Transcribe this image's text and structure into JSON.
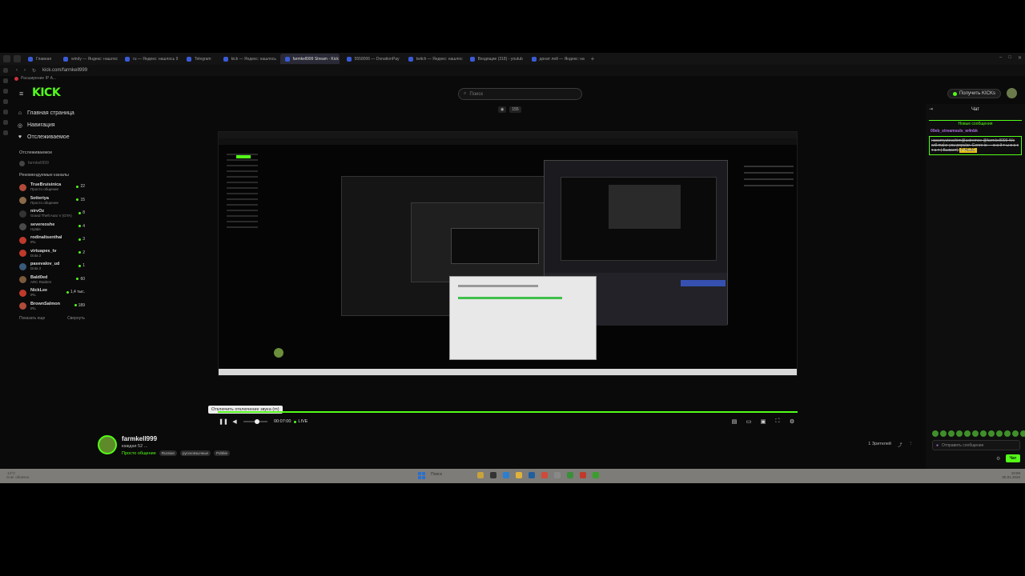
{
  "browser": {
    "tabs": [
      {
        "label": "Главная",
        "active": false
      },
      {
        "label": "windy — Яндекс: нашлось",
        "active": false
      },
      {
        "label": "ru — Яндекс: нашлось 9",
        "active": false
      },
      {
        "label": "Telegram",
        "active": false
      },
      {
        "label": "kick — Яндекс: нашлось",
        "active": false
      },
      {
        "label": "farmkell999 Stream - Kick",
        "active": true
      },
      {
        "label": "5558006 — DonationPay",
        "active": false
      },
      {
        "label": "twitch — Яндекс: нашлось",
        "active": false
      },
      {
        "label": "Входящие (318) - youtub",
        "active": false
      },
      {
        "label": "донат лей — Яндекс: на",
        "active": false
      }
    ],
    "new_tab": "+",
    "url": "kick.com/farmkell999",
    "extension_label": "Расширение IP А..."
  },
  "header": {
    "logo": "KICK",
    "search_placeholder": "Поиск",
    "get_kicks": "Получить KICKs"
  },
  "nav": {
    "items": [
      {
        "icon": "⌂",
        "label": "Главная страница"
      },
      {
        "icon": "◎",
        "label": "Навигация"
      },
      {
        "icon": "♥",
        "label": "Отслеживаемое"
      }
    ],
    "followed_title": "Отслеживаемое",
    "followed_user": "farmkell999",
    "recommended_title": "Рекомендуемые каналы",
    "channels": [
      {
        "name": "TrueBruisinica",
        "game": "Просто общение",
        "viewers": "22",
        "color": "#b04a3a"
      },
      {
        "name": "5otteriya",
        "game": "Просто общение",
        "viewers": "15",
        "color": "#8a6a4a"
      },
      {
        "name": "nirvOz",
        "game": "Grand Theft Auto V (GTA)",
        "viewers": "8",
        "color": "#333333"
      },
      {
        "name": "severeoshe",
        "game": "Hytale",
        "viewers": "4",
        "color": "#4a4a4a"
      },
      {
        "name": "rodinaltsenthal",
        "game": "IRL",
        "viewers": "3",
        "color": "#c0392b"
      },
      {
        "name": "virtuapes_tv",
        "game": "Dota 2",
        "viewers": "2",
        "color": "#c0392b"
      },
      {
        "name": "pasevalov_ud",
        "game": "Dota 2",
        "viewers": "1",
        "color": "#3a5a7a"
      },
      {
        "name": "Bald0ed",
        "game": "ARC Raiders",
        "viewers": "60",
        "color": "#7a5a3a"
      },
      {
        "name": "NickLee",
        "game": "IRL",
        "viewers": "1,4 тыс.",
        "color": "#c0392b"
      },
      {
        "name": "BrownSalmon",
        "game": "IRL",
        "viewers": "189",
        "color": "#b04a3a"
      }
    ],
    "show_more": "Показать еще",
    "collapse": "Свернуть"
  },
  "player": {
    "viewer_count": "155",
    "tooltip": "Отключить отключение звука (m)",
    "time": "00:07:00",
    "live": "LIVE",
    "volume": 0.5
  },
  "streamer": {
    "name": "farmkell999",
    "title": "каждая 52 ...",
    "category": "Просто общение",
    "tags": [
      "Russian",
      "русскоязычные",
      "Pobbie"
    ],
    "viewers_label": "1 Зрителей"
  },
  "chat": {
    "title": "Чат",
    "new_messages": "Новые сообщения",
    "username": "00eb_streamsuls_w4nbk",
    "message": "наsamyuteschim@ustremov @farmkell999 We will make you popular. Genre is — в а й т ы в а с т а т ( Бывает)",
    "message_highlight": "Р НЕЗЕ",
    "input_placeholder": "Отправить сообщение",
    "send_label": "Чат"
  },
  "taskbar": {
    "weather_line1": "-13°C",
    "weather_line2": "Снег облачно",
    "search_placeholder": "Поиск",
    "clock_time": "19:59",
    "clock_date": "05.01.2026"
  },
  "colors": {
    "accent": "#53fc18",
    "chat_username": "#b06fe0"
  }
}
